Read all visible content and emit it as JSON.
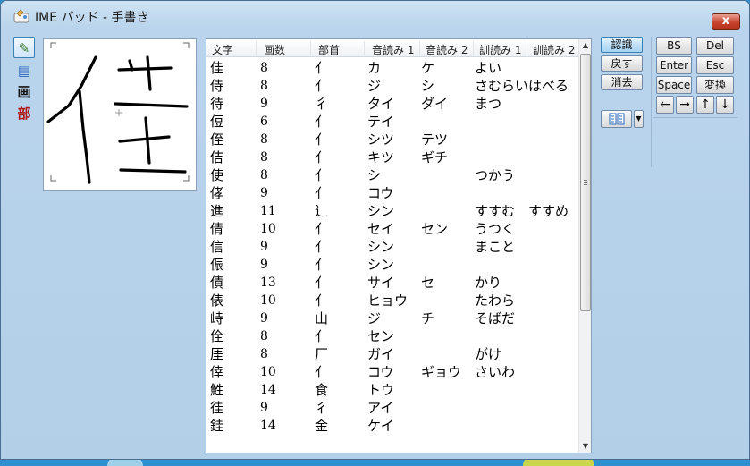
{
  "window": {
    "title": "IME パッド - 手書き",
    "close_label": "x"
  },
  "toolbar": {
    "tools": [
      {
        "name": "handwriting",
        "glyph": "✎"
      },
      {
        "name": "character-list",
        "glyph": "▤"
      },
      {
        "name": "stroke-count",
        "glyph": "画"
      },
      {
        "name": "radical",
        "glyph": "部"
      }
    ]
  },
  "list": {
    "headers": [
      "文字",
      "画数",
      "部首",
      "音読み 1",
      "音読み 2",
      "訓読み 1",
      "訓読み 2"
    ],
    "rows": [
      [
        "佳",
        "8",
        "亻",
        "カ",
        "ケ",
        "よい",
        ""
      ],
      [
        "侍",
        "8",
        "亻",
        "ジ",
        "シ",
        "さむらい",
        "はべる"
      ],
      [
        "待",
        "9",
        "彳",
        "タイ",
        "ダイ",
        "まつ",
        ""
      ],
      [
        "侸",
        "6",
        "亻",
        "テイ",
        "",
        "",
        ""
      ],
      [
        "侄",
        "8",
        "亻",
        "シツ",
        "テツ",
        "",
        ""
      ],
      [
        "佶",
        "8",
        "亻",
        "キツ",
        "ギチ",
        "",
        ""
      ],
      [
        "使",
        "8",
        "亻",
        "シ",
        "",
        "つかう",
        ""
      ],
      [
        "侾",
        "9",
        "亻",
        "コウ",
        "",
        "",
        ""
      ],
      [
        "進",
        "11",
        "辶",
        "シン",
        "",
        "すすむ",
        "すすめ"
      ],
      [
        "倩",
        "10",
        "亻",
        "セイ",
        "セン",
        "うつく",
        ""
      ],
      [
        "信",
        "9",
        "亻",
        "シン",
        "",
        "まこと",
        ""
      ],
      [
        "侲",
        "9",
        "亻",
        "シン",
        "",
        "",
        ""
      ],
      [
        "債",
        "13",
        "亻",
        "サイ",
        "セ",
        "かり",
        ""
      ],
      [
        "俵",
        "10",
        "亻",
        "ヒョウ",
        "",
        "たわら",
        ""
      ],
      [
        "峙",
        "9",
        "山",
        "ジ",
        "チ",
        "そばだ",
        ""
      ],
      [
        "佺",
        "8",
        "亻",
        "セン",
        "",
        "",
        ""
      ],
      [
        "厓",
        "8",
        "厂",
        "ガイ",
        "",
        "がけ",
        ""
      ],
      [
        "倖",
        "10",
        "亻",
        "コウ",
        "ギョウ",
        "さいわ",
        ""
      ],
      [
        "鮏",
        "14",
        "食",
        "トウ",
        "",
        "",
        ""
      ],
      [
        "徍",
        "9",
        "彳",
        "アイ",
        "",
        "",
        ""
      ],
      [
        "銈",
        "14",
        "金",
        "ケイ",
        "",
        "",
        ""
      ]
    ]
  },
  "actions": {
    "recognize": "認識",
    "undo": "戻す",
    "clear": "消去"
  },
  "keys": {
    "bs": "BS",
    "del": "Del",
    "enter": "Enter",
    "esc": "Esc",
    "space": "Space",
    "convert": "変換",
    "left": "←",
    "right": "→",
    "up": "↑",
    "down": "↓"
  },
  "colors": {
    "accent": "#3c7fb1",
    "titlebar": "#cfe3f4",
    "close": "#c8452f"
  }
}
